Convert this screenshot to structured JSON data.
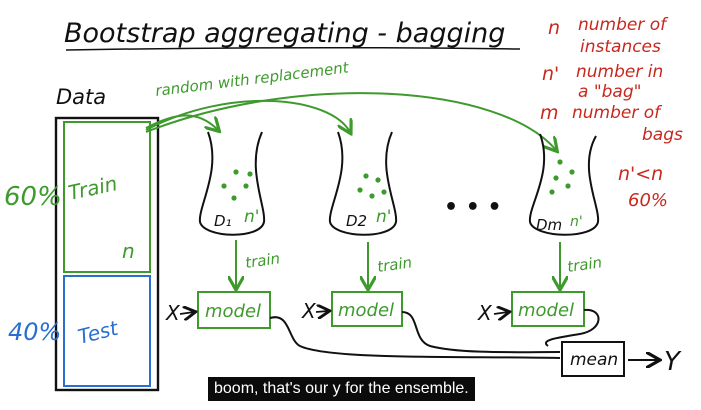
{
  "title": "Bootstrap aggregating - bagging",
  "legend": [
    {
      "symbol": "n",
      "text": "number of",
      "text2": "instances"
    },
    {
      "symbol": "n'",
      "text": "number in",
      "text2": "a \"bag\""
    },
    {
      "symbol": "m",
      "text": "number of",
      "text2": "bags"
    }
  ],
  "constraint": {
    "line1": "n'<n",
    "line2": "60%"
  },
  "data_label": "Data",
  "replacement_note": "random with replacement",
  "split": {
    "train_pct": "60%",
    "test_pct": "40%",
    "train_label": "Train",
    "test_label": "Test",
    "n_label": "n"
  },
  "bags": [
    {
      "name": "D₁",
      "size": "n'"
    },
    {
      "name": "D2",
      "size": "n'"
    },
    {
      "name": "Dm",
      "size": "n'"
    }
  ],
  "ellipsis": "• • •",
  "train_arrow_label": "train",
  "model_label": "model",
  "input_label": "X",
  "mean_label": "mean",
  "output_label": "Y",
  "caption": "boom, that's our y for the ensemble.",
  "colors": {
    "ink": "#111111",
    "green": "#3f9a2e",
    "red": "#c8281d",
    "blue": "#2a6fd0"
  }
}
